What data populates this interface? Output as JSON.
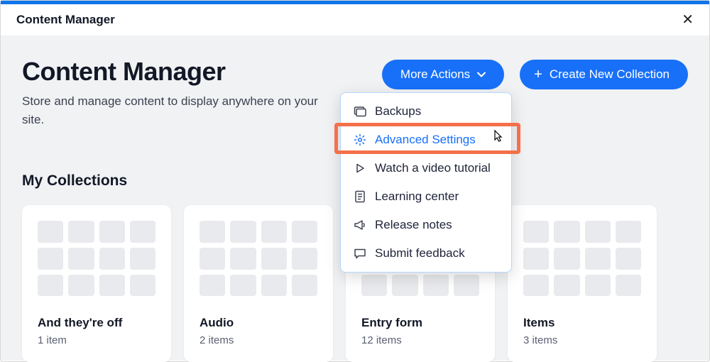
{
  "header": {
    "title": "Content Manager"
  },
  "page": {
    "title": "Content Manager",
    "subtitle": "Store and manage content to display anywhere on your site."
  },
  "actions": {
    "more_label": "More Actions",
    "create_label": "Create New Collection"
  },
  "dropdown": {
    "items": [
      {
        "label": "Backups"
      },
      {
        "label": "Advanced Settings"
      },
      {
        "label": "Watch a video tutorial"
      },
      {
        "label": "Learning center"
      },
      {
        "label": "Release notes"
      },
      {
        "label": "Submit feedback"
      }
    ]
  },
  "section": {
    "title": "My Collections"
  },
  "collections": [
    {
      "title": "And they're off",
      "sub": "1 item"
    },
    {
      "title": "Audio",
      "sub": "2 items"
    },
    {
      "title": "Entry form",
      "sub": "12 items"
    },
    {
      "title": "Items",
      "sub": "3 items"
    }
  ]
}
